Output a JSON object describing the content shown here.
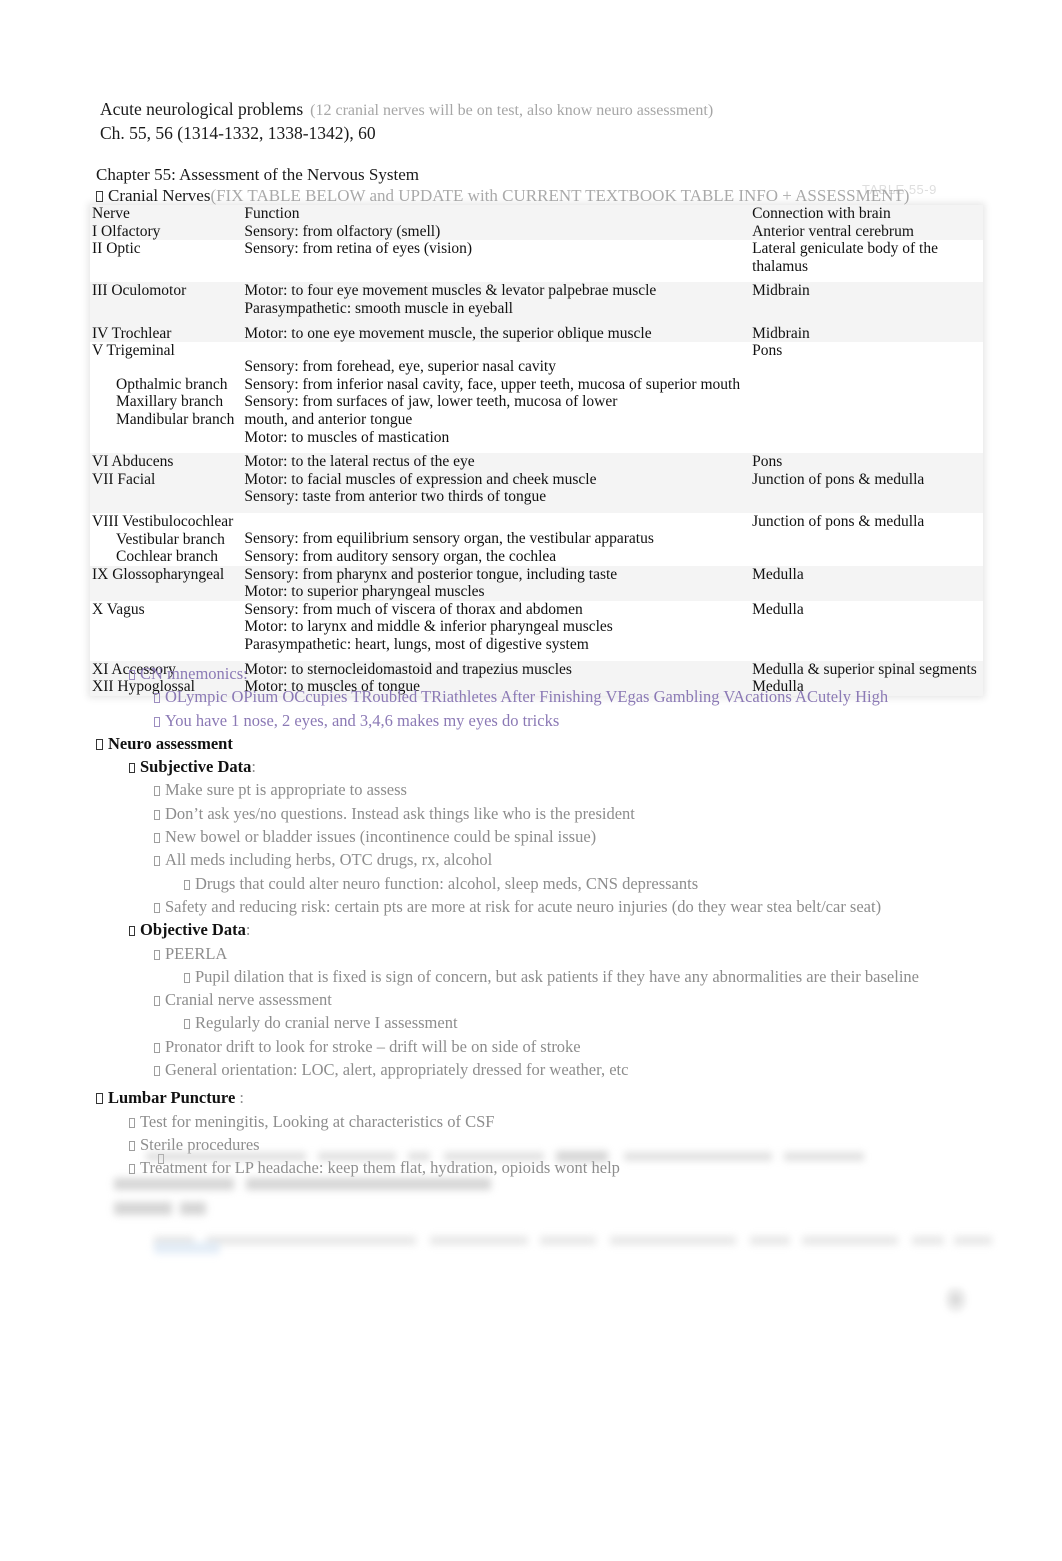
{
  "document": {
    "heading": {
      "title": "Acute neurological problems",
      "title_note": "(12 cranial nerves will be on test, also know neuro assessment)",
      "subtitle": "Ch. 55, 56 (1314-1332, 1338-1342), 60"
    },
    "chapter": {
      "title": "Chapter 55: Assessment of the Nervous System",
      "cranial_nerves_label": "Cranial Nerves",
      "cranial_nerves_note": "(FIX TABLE BELOW and UPDATE with CURRENT TEXTBOOK TABLE INFO + ASSESSMENT)"
    },
    "watermark": "TABLE 55-9"
  },
  "table": {
    "headers": [
      "Nerve",
      "Function",
      "Connection with brain"
    ],
    "rows": [
      {
        "nerve": [
          "I Olfactory"
        ],
        "function": [
          "Sensory: from olfactory (smell)"
        ],
        "connection": [
          "Anterior ventral cerebrum"
        ]
      },
      {
        "nerve": [
          "II Optic"
        ],
        "function": [
          "Sensory: from retina of eyes (vision)"
        ],
        "connection": [
          "Lateral geniculate body of the",
          "thalamus"
        ]
      },
      {
        "nerve": [
          "III Oculomotor"
        ],
        "function": [
          "Motor: to four eye movement muscles & levator palpebrae muscle",
          "Parasympathetic: smooth muscle in eyeball"
        ],
        "connection": [
          "Midbrain"
        ]
      },
      {
        "nerve": [
          "IV Trochlear"
        ],
        "function": [
          "Motor: to one eye movement muscle, the superior oblique muscle"
        ],
        "connection": [
          "Midbrain"
        ]
      },
      {
        "nerve": [
          "V Trigeminal",
          "Opthalmic branch",
          "Maxillary branch",
          "Mandibular branch"
        ],
        "function": [
          "Sensory: from forehead, eye, superior nasal cavity",
          "Sensory: from inferior nasal cavity, face, upper teeth, mucosa of superior mouth",
          "Sensory: from surfaces of jaw, lower teeth, mucosa of lower mouth, and anterior tongue",
          "Motor: to muscles of mastication"
        ],
        "connection": [
          "Pons"
        ]
      },
      {
        "nerve": [
          "VI  Abducens"
        ],
        "function": [
          "Motor: to the lateral rectus of the eye"
        ],
        "connection": [
          "Pons"
        ]
      },
      {
        "nerve": [
          "VII  Facial"
        ],
        "function": [
          "Motor: to facial muscles of expression and cheek muscle",
          "Sensory: taste from anterior two thirds of tongue"
        ],
        "connection": [
          "Junction of pons & medulla"
        ]
      },
      {
        "nerve": [
          "VIII Vestibulocochlear",
          "Vestibular branch",
          "Cochlear branch"
        ],
        "function": [
          "Sensory: from equilibrium sensory organ, the vestibular apparatus",
          "Sensory: from auditory sensory organ, the cochlea"
        ],
        "connection": [
          "Junction of pons & medulla"
        ]
      },
      {
        "nerve": [
          "IX Glossopharyngeal"
        ],
        "function": [
          "Sensory: from pharynx and posterior tongue, including taste",
          "Motor: to superior pharyngeal muscles"
        ],
        "connection": [
          "Medulla"
        ]
      },
      {
        "nerve": [
          "X  Vagus"
        ],
        "function": [
          "Sensory: from much of viscera of thorax and abdomen",
          "Motor: to larynx and middle & inferior pharyngeal muscles",
          "Parasympathetic: heart, lungs, most of digestive system"
        ],
        "connection": [
          "Medulla"
        ]
      },
      {
        "nerve": [
          "XI  Accessory"
        ],
        "function": [
          "Motor: to sternocleidomastoid and trapezius muscles"
        ],
        "connection": [
          "Medulla & superior spinal segments"
        ]
      },
      {
        "nerve": [
          "XII  Hypoglossal"
        ],
        "function": [
          "Motor: to muscles of tongue"
        ],
        "connection": [
          "Medulla"
        ]
      }
    ]
  },
  "outline": {
    "cn_mnemonics_label": "CN mnemonics:",
    "mnemonic_1": "OLympic OPium OCcupies TRoubled TRiathletes After Finishing VEgas Gambling VAcations ACutely High",
    "mnemonic_2": "You have 1 nose, 2 eyes, and 3,4,6 makes my eyes do tricks",
    "neuro_assessment_label": "Neuro assessment",
    "subjective_label": "Subjective Data",
    "subjective_colon": ":",
    "subjective_items": [
      "Make sure pt is appropriate to assess",
      "Don’t ask yes/no questions. Instead ask things like who is the president",
      "New bowel or bladder issues (incontinence could be spinal issue)",
      "All meds including herbs, OTC drugs, rx, alcohol"
    ],
    "subjective_sub_item": "Drugs that could alter neuro function: alcohol, sleep meds, CNS depressants",
    "subjective_last": "Safety and reducing risk: certain pts are more at risk for acute neuro injuries (do they wear stea belt/car seat)",
    "objective_label": "Objective Data",
    "objective_colon": ":",
    "peerla": "PEERLA",
    "peerla_sub": "Pupil dilation that is fixed is sign of concern, but ask patients if they have any abnormalities are their baseline",
    "cranial_nerve_assessment": "Cranial nerve assessment",
    "cranial_nerve_assessment_sub": "Regularly do cranial nerve I assessment",
    "pronator_drift": "Pronator drift to look for stroke – drift will be on side of stroke",
    "general_orientation": "General orientation: LOC, alert, appropriately dressed for weather, etc",
    "lumbar_puncture_label": "Lumbar Puncture",
    "lumbar_puncture_colon": ":",
    "lumbar_items": [
      "Test for meningitis, Looking at characteristics of CSF",
      "Sterile procedures",
      "Treatment for LP headache: keep them flat, hydration, opioids wont help"
    ]
  },
  "colors": {
    "mnemonic_purple": "#8b79b5",
    "body_gray": "#8d8d8d",
    "note_gray": "#aaaaaa",
    "text_black": "#111111"
  }
}
